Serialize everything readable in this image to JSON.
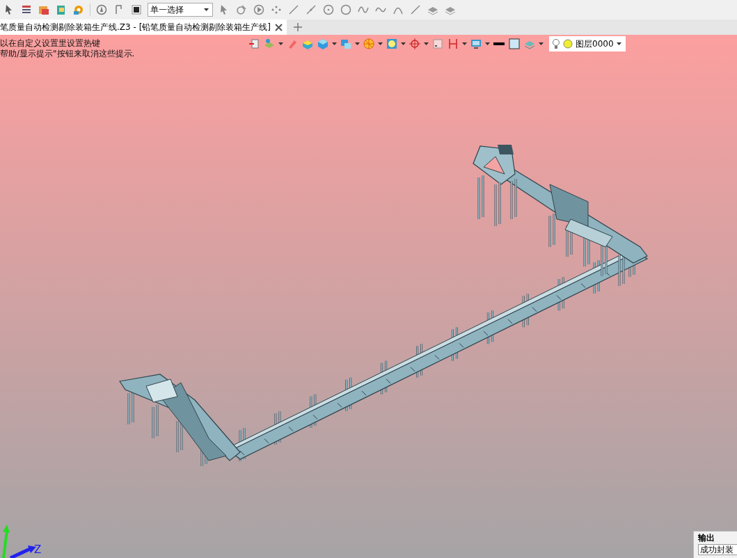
{
  "toolbar": {
    "select_mode": "单一选择"
  },
  "tabs": [
    {
      "label": "笔质量自动检测剔除装箱生产线.Z3 - [铅笔质量自动检测剔除装箱生产线]",
      "selected": true
    }
  ],
  "viewport": {
    "hints": [
      "以在自定义设置里设置热键",
      "帮助/显示提示\"按钮来取消这些提示."
    ],
    "layer": "图层0000",
    "axis_label": "Z"
  },
  "output_panel": {
    "title": "输出",
    "text": "成功封装"
  }
}
